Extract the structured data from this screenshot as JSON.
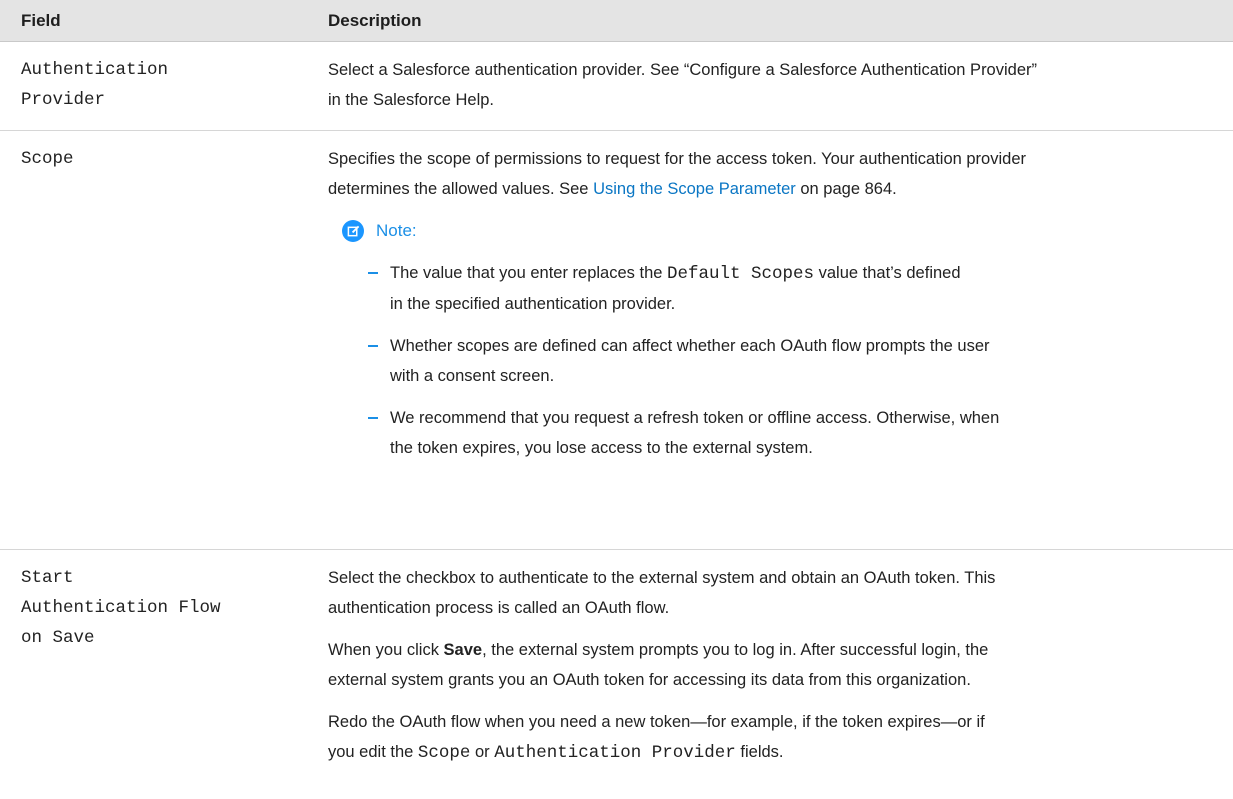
{
  "header": {
    "field": "Field",
    "description": "Description"
  },
  "rows": {
    "auth_provider": {
      "field_line1": "Authentication",
      "field_line2": "Provider",
      "desc_line1": "Select a Salesforce authentication provider. See “Configure a Salesforce Authentication Provider”",
      "desc_line2": "in the Salesforce Help."
    },
    "scope": {
      "field": "Scope",
      "desc_line1": "Specifies the scope of permissions to request for the access token. Your authentication provider",
      "desc_line2_pre": "determines the allowed values. See ",
      "desc_link": "Using the Scope Parameter",
      "desc_line2_post": " on page 864.",
      "note_label": "Note:",
      "note_icon": "edit-note-icon",
      "bullets": [
        {
          "line1_pre": "The value that you enter replaces the ",
          "line1_code": "Default Scopes",
          "line1_post": " value that’s defined",
          "line2": "in the specified authentication provider."
        },
        {
          "line1": "Whether scopes are defined can affect whether each OAuth flow prompts the user",
          "line2": "with a consent screen."
        },
        {
          "line1": "We recommend that you request a refresh token or offline access. Otherwise, when",
          "line2": "the token expires, you lose access to the external system."
        }
      ]
    },
    "start_flow": {
      "field_line1": "Start",
      "field_line2": "Authentication Flow",
      "field_line3": "on Save",
      "p1_line1": "Select the checkbox to authenticate to the external system and obtain an OAuth token. This",
      "p1_line2": "authentication process is called an OAuth flow.",
      "p2_pre": "When you click ",
      "p2_bold": "Save",
      "p2_post": ", the external system prompts you to log in. After successful login, the",
      "p2_line2": "external system grants you an OAuth token for accessing its data from this organization.",
      "p3_line1": "Redo the OAuth flow when you need a new token—for example, if the token expires—or if",
      "p3_pre": "you edit the ",
      "p3_code1": "Scope",
      "p3_mid": " or ",
      "p3_code2": "Authentication Provider",
      "p3_post": " fields."
    }
  },
  "colors": {
    "header_bg": "#e4e4e4",
    "link": "#0a76c4",
    "note_accent": "#1b96ff"
  }
}
